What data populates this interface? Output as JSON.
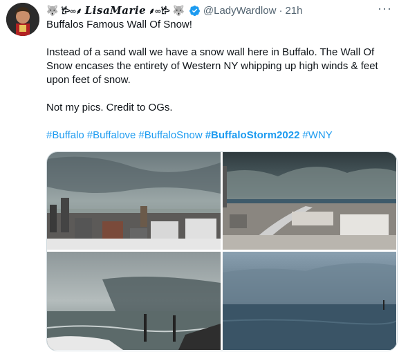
{
  "tweet": {
    "display_name": "LisaMarie",
    "name_prefix_icon": "fox-icon",
    "name_suffix_icon": "fox-icon",
    "handle": "@LadyWardlow",
    "separator": "·",
    "time": "21h",
    "more_icon": "more-icon",
    "more_label": "···",
    "title_line": "Buffalos Famous Wall Of Snow!",
    "paragraph": "Instead of a sand wall we have a snow wall here in Buffalo. The Wall Of Snow encases the entirety of Western NY whipping up high winds & feet upon feet of snow.",
    "credit": "Not my pics. Credit to OGs.",
    "hashtags": [
      {
        "text": "#Buffalo",
        "bold": false
      },
      {
        "text": "#Buffalove",
        "bold": false
      },
      {
        "text": "#BuffaloSnow",
        "bold": false
      },
      {
        "text": "#BuffaloStorm2022",
        "bold": true
      },
      {
        "text": "#WNY",
        "bold": false
      }
    ],
    "colors": {
      "link": "#1d9bf0",
      "text": "#0f1419",
      "secondary": "#536471",
      "verified": "#1d9bf0"
    },
    "photos": [
      {
        "name": "photo-city-storm"
      },
      {
        "name": "photo-snow-wall-skyline"
      },
      {
        "name": "photo-shoreline-storm"
      },
      {
        "name": "photo-lake-snow-wall"
      }
    ]
  }
}
